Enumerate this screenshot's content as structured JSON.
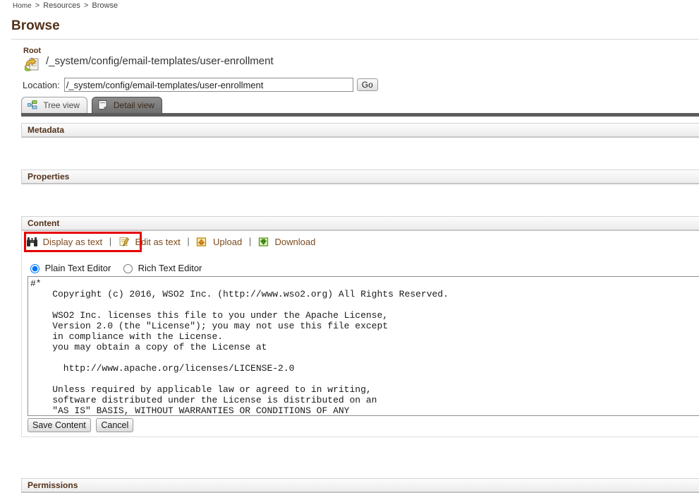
{
  "breadcrumb": {
    "home": "Home",
    "sep1": ">",
    "resources": "Resources",
    "sep2": ">",
    "browse": "Browse"
  },
  "page": {
    "title": "Browse"
  },
  "root": {
    "label": "Root",
    "icon": "folder-up-icon",
    "path": "/_system/config/email-templates/user-enrollment"
  },
  "location": {
    "label": "Location:",
    "value": "/_system/config/email-templates/user-enrollment",
    "placeholder": "",
    "go_label": "Go"
  },
  "tabs": [
    {
      "label": "Tree view",
      "icon": "tree-view-icon",
      "active": false
    },
    {
      "label": "Detail view",
      "icon": "detail-view-icon",
      "active": true
    }
  ],
  "sections": {
    "metadata": {
      "title": "Metadata"
    },
    "properties": {
      "title": "Properties"
    },
    "content": {
      "title": "Content"
    },
    "permissions": {
      "title": "Permissions"
    }
  },
  "content_toolbar": {
    "display_as_text": {
      "label": "Display as text",
      "icon": "binoculars-icon",
      "highlighted": true
    },
    "edit_as_text": {
      "label": "Edit as text",
      "icon": "pencil-note-icon"
    },
    "upload": {
      "label": "Upload",
      "icon": "upload-arrow-icon"
    },
    "download": {
      "label": "Download",
      "icon": "download-arrow-icon"
    },
    "separator": "|"
  },
  "editor": {
    "plain_label": "Plain Text Editor",
    "rich_label": "Rich Text Editor",
    "selected": "plain",
    "text": "#*\n    Copyright (c) 2016, WSO2 Inc. (http://www.wso2.org) All Rights Reserved.\n\n    WSO2 Inc. licenses this file to you under the Apache License,\n    Version 2.0 (the \"License\"); you may not use this file except\n    in compliance with the License.\n    you may obtain a copy of the License at\n\n      http://www.apache.org/licenses/LICENSE-2.0\n\n    Unless required by applicable law or agreed to in writing,\n    software distributed under the License is distributed on an\n    \"AS IS\" BASIS, WITHOUT WARRANTIES OR CONDITIONS OF ANY\n    KIND, either express or implied.  See the License for the"
  },
  "content_buttons": {
    "save": "Save Content",
    "cancel": "Cancel"
  },
  "colors": {
    "heading": "#54321a",
    "link": "#7c4a1e",
    "highlight": "#e60000",
    "tab_active_bg": "#7b7b7b",
    "rule": "#d8d8d8"
  }
}
